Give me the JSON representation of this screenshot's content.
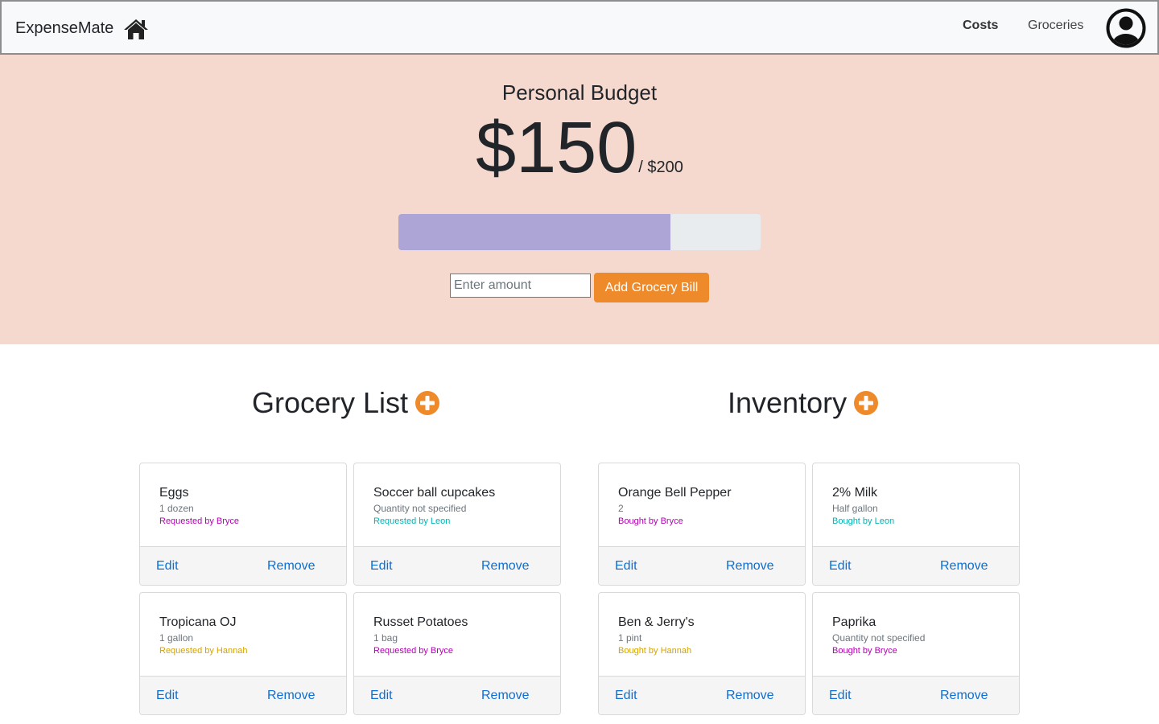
{
  "navbar": {
    "brand": "ExpenseMate",
    "home_icon": "home-icon",
    "links": [
      {
        "label": "Costs",
        "active": true
      },
      {
        "label": "Groceries",
        "active": false
      }
    ],
    "avatar_icon": "user-circle-icon"
  },
  "budget": {
    "title": "Personal Budget",
    "spent": "$150",
    "total": "/ $200",
    "progress_fraction": 0.75,
    "input_placeholder": "Enter amount",
    "add_button_label": "Add Grocery Bill"
  },
  "grocery_list": {
    "heading": "Grocery List",
    "add_icon": "plus-circle-icon",
    "items": [
      {
        "name": "Eggs",
        "quantity": "1 dozen",
        "by": "Requested by Bryce",
        "color": "#b300b3"
      },
      {
        "name": "Soccer ball cupcakes",
        "quantity": "Quantity not specified",
        "by": "Requested by Leon",
        "color": "#00b3b3"
      },
      {
        "name": "Tropicana OJ",
        "quantity": "1 gallon",
        "by": "Requested by Hannah",
        "color": "#d4a400"
      },
      {
        "name": "Russet Potatoes",
        "quantity": "1 bag",
        "by": "Requested by Bryce",
        "color": "#b300b3"
      }
    ]
  },
  "inventory": {
    "heading": "Inventory",
    "add_icon": "plus-circle-icon",
    "items": [
      {
        "name": "Orange Bell Pepper",
        "quantity": "2",
        "by": "Bought by Bryce",
        "color": "#b300b3"
      },
      {
        "name": "2% Milk",
        "quantity": "Half gallon",
        "by": "Bought by Leon",
        "color": "#00b3b3"
      },
      {
        "name": "Ben & Jerry's",
        "quantity": "1 pint",
        "by": "Bought by Hannah",
        "color": "#d4a400"
      },
      {
        "name": "Paprika",
        "quantity": "Quantity not specified",
        "by": "Bought by Bryce",
        "color": "#b300b3"
      }
    ]
  },
  "card_actions": {
    "edit": "Edit",
    "remove": "Remove"
  },
  "colors": {
    "accent": "#ee8a2a",
    "hero_bg": "#f5d9ce",
    "progress_fill": "#aca5d6",
    "link": "#0b6fd6"
  }
}
